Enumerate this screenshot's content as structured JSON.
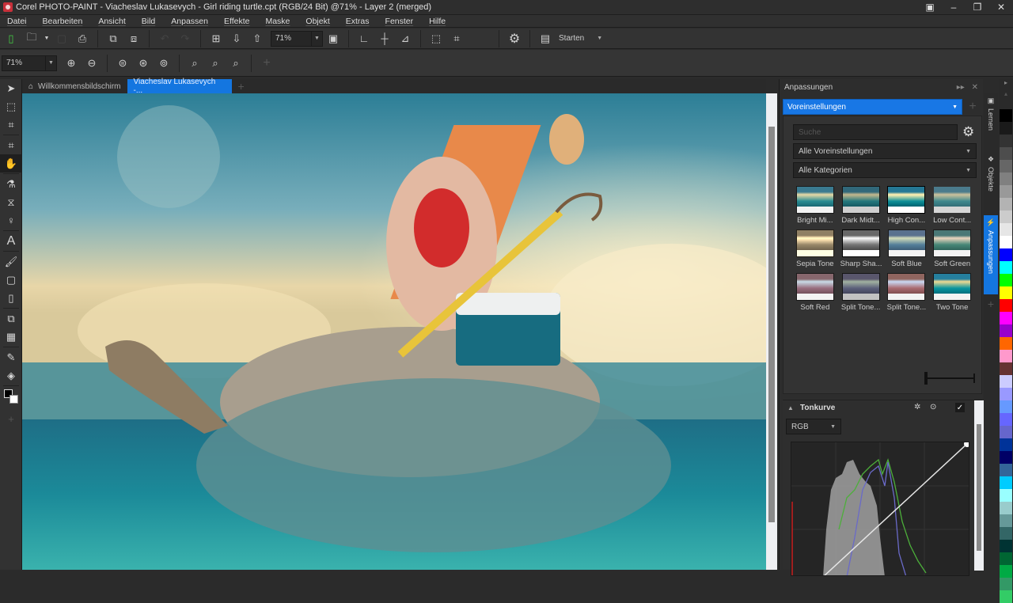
{
  "window": {
    "title": "Corel PHOTO-PAINT - Viacheslav Lukasevych - Girl riding turtle.cpt (RGB/24 Bit) @71% - Layer 2 (merged)",
    "controls": [
      "restore-panel",
      "minimize",
      "restore",
      "close"
    ]
  },
  "menu": [
    "Datei",
    "Bearbeiten",
    "Ansicht",
    "Bild",
    "Anpassen",
    "Effekte",
    "Maske",
    "Objekt",
    "Extras",
    "Fenster",
    "Hilfe"
  ],
  "toolbar": {
    "zoom_value": "71%",
    "workspace_label": "Starten"
  },
  "zoombar": {
    "zoom_value": "71%"
  },
  "tabs": [
    {
      "label": "Willkommensbildschirm",
      "active": false
    },
    {
      "label": "Viacheslav Lukasevych -...",
      "active": true
    }
  ],
  "docker": {
    "title": "Anpassungen",
    "mode": "Voreinstellungen",
    "search_placeholder": "Suche",
    "filter1": "Alle Voreinstellungen",
    "filter2": "Alle Kategorien",
    "presets": [
      [
        "Bright Mi...",
        "Dark Midt...",
        "High Con...",
        "Low Cont..."
      ],
      [
        "Sepia Tone",
        "Sharp Sha...",
        "Soft Blue",
        "Soft Green"
      ],
      [
        "Soft Red",
        "Split Tone...",
        "Split Tone...",
        "Two Tone"
      ]
    ],
    "tonecurve": {
      "title": "Tonkurve",
      "channel": "RGB",
      "enabled": true
    }
  },
  "sidetabs": [
    {
      "label": "Lernen",
      "active": false
    },
    {
      "label": "Objekte",
      "active": false
    },
    {
      "label": "Anpassungen",
      "active": true
    }
  ],
  "palette": [
    "#000000",
    "#1a1a1a",
    "#333333",
    "#4d4d4d",
    "#666666",
    "#808080",
    "#999999",
    "#b3b3b3",
    "#cccccc",
    "#e6e6e6",
    "#ffffff",
    "#0000ff",
    "#00ffff",
    "#00ff00",
    "#ffff00",
    "#ff0000",
    "#ff00ff",
    "#9900cc",
    "#ff6600",
    "#ff99cc",
    "#663333",
    "#ccccff",
    "#9999ff",
    "#6699ff",
    "#6666ff",
    "#6666cc",
    "#003399",
    "#000066",
    "#336699",
    "#00ccff",
    "#99ffff",
    "#99cccc",
    "#669999",
    "#336666",
    "#003333",
    "#006633",
    "#00aa44",
    "#339966",
    "#33cc66"
  ],
  "colors": {
    "accent": "#1476e0"
  }
}
